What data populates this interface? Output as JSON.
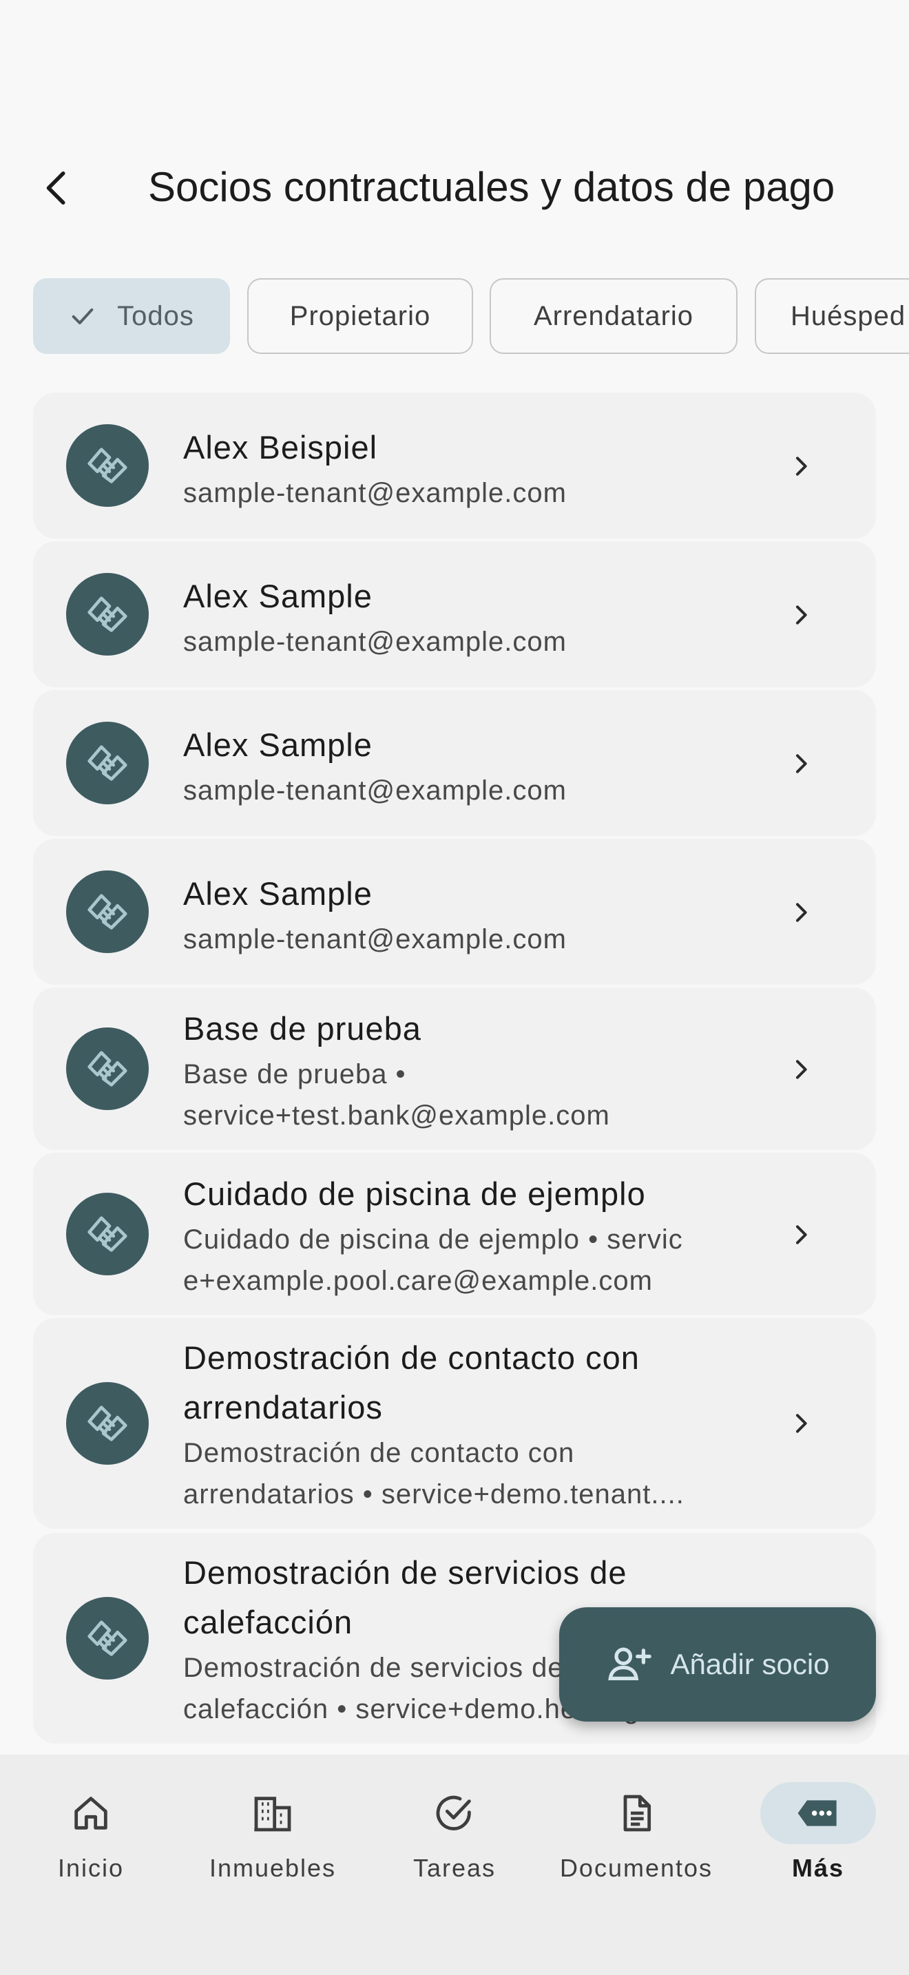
{
  "header": {
    "title": "Socios contractuales y datos de pago"
  },
  "filters": [
    {
      "label": "Todos",
      "selected": true
    },
    {
      "label": "Propietario",
      "selected": false
    },
    {
      "label": "Arrendatario",
      "selected": false
    },
    {
      "label": "Huésped",
      "selected": false
    }
  ],
  "partners": [
    {
      "title": "Alex Beispiel",
      "subtitle": "sample-tenant@example.com"
    },
    {
      "title": "Alex Sample",
      "subtitle": "sample-tenant@example.com"
    },
    {
      "title": "Alex Sample",
      "subtitle": "sample-tenant@example.com"
    },
    {
      "title": "Alex Sample",
      "subtitle": "sample-tenant@example.com"
    },
    {
      "title": "Base de prueba",
      "subtitle_line1": "Base de prueba •",
      "subtitle_line2": "service+test.bank@example.com"
    },
    {
      "title": "Cuidado de piscina de ejemplo",
      "subtitle_line1": "Cuidado de piscina de ejemplo • servic",
      "subtitle_line2": "e+example.pool.care@example.com"
    },
    {
      "title_line1": "Demostración de contacto con",
      "title_line2": "arrendatarios",
      "subtitle_line1": "Demostración de contacto con",
      "subtitle_line2": "arrendatarios • service+demo.tenant...."
    },
    {
      "title_line1": "Demostración de servicios de",
      "title_line2": "calefacción",
      "subtitle_line1": "Demostración de servicios de",
      "subtitle_line2": "calefacción • service+demo.heating..."
    }
  ],
  "fab": {
    "label": "Añadir socio"
  },
  "nav": [
    {
      "label": "Inicio",
      "icon": "home-icon"
    },
    {
      "label": "Inmuebles",
      "icon": "building-icon"
    },
    {
      "label": "Tareas",
      "icon": "check-circle-icon"
    },
    {
      "label": "Documentos",
      "icon": "document-icon"
    },
    {
      "label": "Más",
      "icon": "more-icon",
      "active": true
    }
  ],
  "colors": {
    "accent": "#3e5b60",
    "chip_selected": "#d6e2e7",
    "background": "#f8f8f8"
  }
}
